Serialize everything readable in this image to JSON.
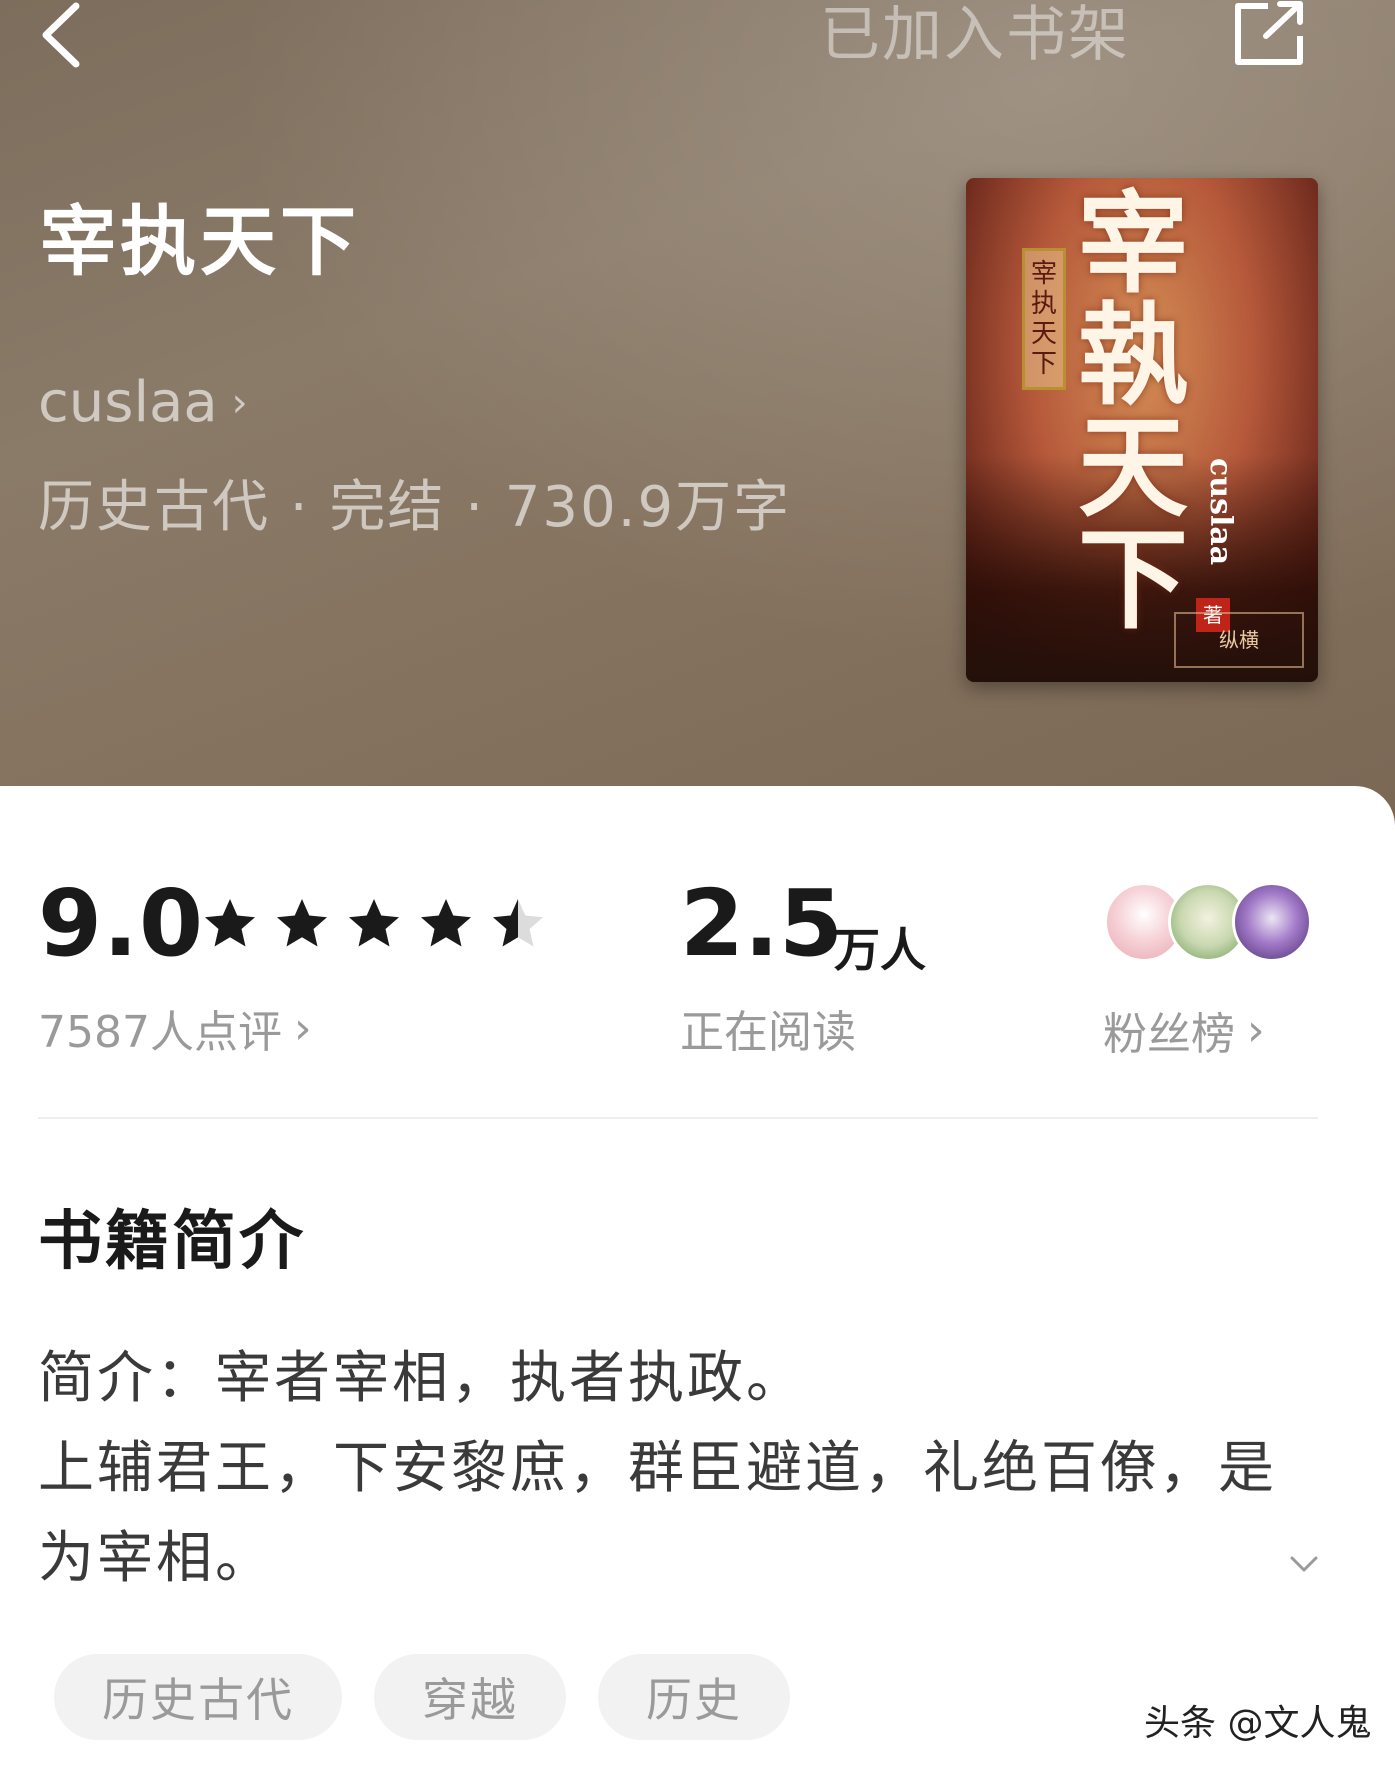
{
  "header": {
    "back_icon": "chevron-left-icon",
    "shelf_status": "已加入书架",
    "share_icon": "share-external-icon"
  },
  "book": {
    "title": "宰执天下",
    "author": "cuslaa",
    "meta": "历史古代 · 完结 · 730.9万字",
    "cover": {
      "big_title": "宰執天下",
      "small_title": "宰执天下",
      "author": "cuslaa",
      "seal": "著",
      "publisher": "纵横"
    }
  },
  "stats": {
    "score": "9.0",
    "star_rating": 4.5,
    "reviews": "7587人点评",
    "readers_num": "2.5",
    "readers_unit": "万人",
    "readers_label": "正在阅读",
    "fans_label": "粉丝榜",
    "colors": {
      "star": "#1a1a1a",
      "star_empty": "#dcdcdc"
    }
  },
  "intro": {
    "section_title": "书籍简介",
    "line1": "简介：宰者宰相，执者执政。",
    "line2": "上辅君王，下安黎庶，群臣避道，礼绝百僚，是为宰相。"
  },
  "tags": [
    "历史古代",
    "穿越",
    "历史"
  ],
  "watermark": "头条 @文人鬼"
}
